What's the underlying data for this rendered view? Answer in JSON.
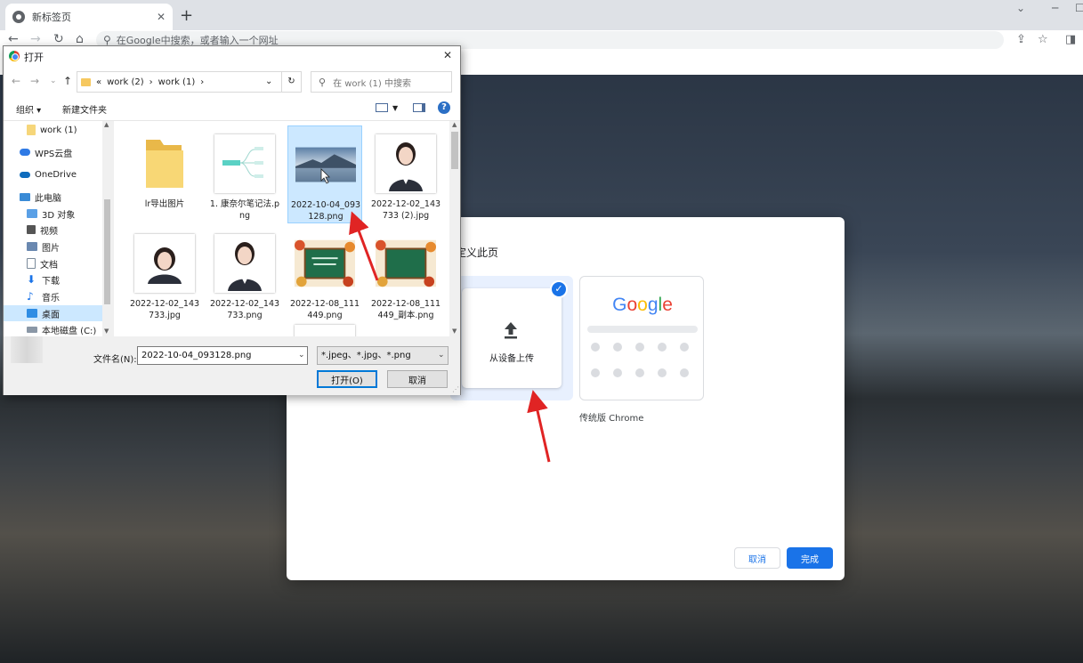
{
  "browser": {
    "tab_title": "新标签页",
    "tab_close": "✕",
    "new_tab": "+",
    "omnibox_placeholder": "在Google中搜索，或者输入一个网址"
  },
  "customize_dialog": {
    "title": "定义此页",
    "upload_label": "从设备上传",
    "classic_logo": "Google",
    "classic_label": "传统版 Chrome",
    "cancel": "取消",
    "done": "完成",
    "accent_color": "#1a73e8"
  },
  "file_dialog": {
    "title": "打开",
    "breadcrumb": [
      "«",
      "work (2)",
      "›",
      "work (1)",
      "›"
    ],
    "search_placeholder": "在 work (1) 中搜索",
    "organize": "组织 ▾",
    "new_folder": "新建文件夹",
    "help": "?",
    "sidebar": [
      {
        "label": "work (1)",
        "icon": "folder-icon",
        "selected": false
      },
      {
        "label": "WPS云盘",
        "icon": "cloud-icon",
        "selected": false
      },
      {
        "label": "OneDrive",
        "icon": "onedrive-icon",
        "selected": false
      },
      {
        "label": "此电脑",
        "icon": "computer-icon",
        "selected": false
      },
      {
        "label": "3D 对象",
        "icon": "cube-icon",
        "selected": false
      },
      {
        "label": "视频",
        "icon": "video-icon",
        "selected": false
      },
      {
        "label": "图片",
        "icon": "picture-icon",
        "selected": false
      },
      {
        "label": "文档",
        "icon": "document-icon",
        "selected": false
      },
      {
        "label": "下载",
        "icon": "download-icon",
        "selected": false
      },
      {
        "label": "音乐",
        "icon": "music-icon",
        "selected": false
      },
      {
        "label": "桌面",
        "icon": "desktop-icon",
        "selected": true
      },
      {
        "label": "本地磁盘 (C:)",
        "icon": "drive-icon",
        "selected": false
      }
    ],
    "files": [
      {
        "name": "lr导出图片",
        "kind": "folder",
        "selected": false
      },
      {
        "name": "1. 康奈尔笔记法.png",
        "kind": "mindmap",
        "selected": false
      },
      {
        "name": "2022-10-04_093128.png",
        "kind": "landscape",
        "selected": true
      },
      {
        "name": "2022-12-02_143733 (2).jpg",
        "kind": "portrait",
        "selected": false
      },
      {
        "name": "2022-12-02_143733.jpg",
        "kind": "portrait-wide",
        "selected": false
      },
      {
        "name": "2022-12-02_143733.png",
        "kind": "portrait",
        "selected": false
      },
      {
        "name": "2022-12-08_111449.png",
        "kind": "chalkboard",
        "selected": false
      },
      {
        "name": "2022-12-08_111449_副本.png",
        "kind": "chalkboard",
        "selected": false
      },
      {
        "name": "",
        "kind": "stamp",
        "selected": false
      }
    ],
    "filename_label": "文件名(N):",
    "filename_value": "2022-10-04_093128.png",
    "filetype_value": "*.jpeg、*.jpg、*.png",
    "open_button": "打开(O)",
    "cancel_button": "取消"
  }
}
